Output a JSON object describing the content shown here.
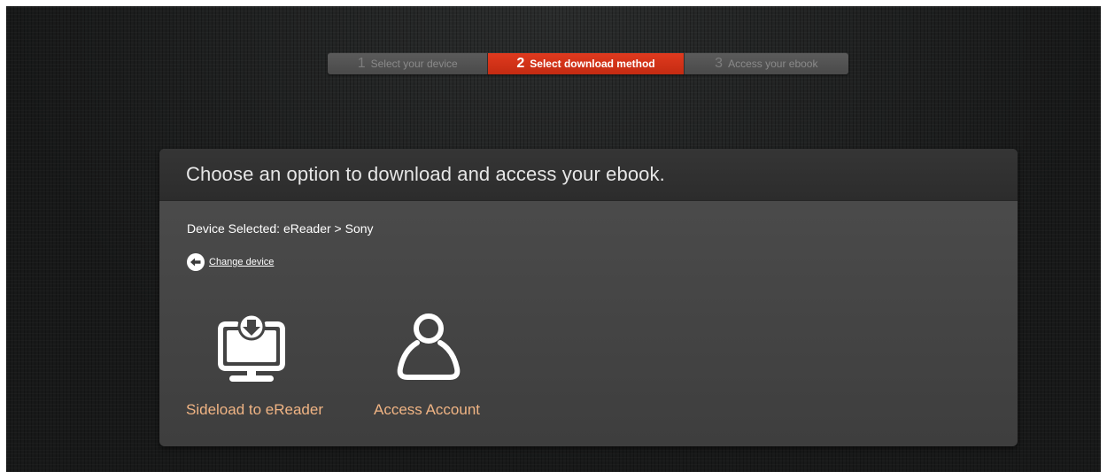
{
  "steps": [
    {
      "number": "1",
      "label": "Select your device",
      "state": "inactive"
    },
    {
      "number": "2",
      "label": "Select download method",
      "state": "active"
    },
    {
      "number": "3",
      "label": "Access your ebook",
      "state": "inactive"
    }
  ],
  "panel": {
    "title": "Choose an option to download and access your ebook.",
    "device_selected": "Device Selected: eReader > Sony",
    "change_device_label": "Change device",
    "options": [
      {
        "label": "Sideload to eReader",
        "icon": "monitor-download-icon"
      },
      {
        "label": "Access Account",
        "icon": "user-account-icon"
      }
    ]
  },
  "colors": {
    "active_step": "#d4331a",
    "option_label": "#f0b484",
    "background": "#1c1d1d"
  }
}
